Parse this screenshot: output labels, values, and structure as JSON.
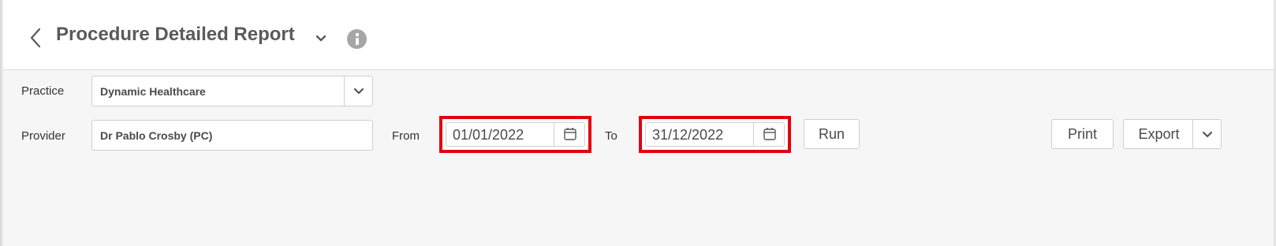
{
  "header": {
    "title": "Procedure Detailed Report"
  },
  "filters": {
    "practice_label": "Practice",
    "practice_value": "Dynamic Healthcare",
    "provider_label": "Provider",
    "provider_value": "Dr Pablo Crosby (PC)",
    "from_label": "From",
    "from_value": "01/01/2022",
    "to_label": "To",
    "to_value": "31/12/2022"
  },
  "actions": {
    "run_label": "Run",
    "print_label": "Print",
    "export_label": "Export"
  },
  "colors": {
    "highlight": "#e3000f",
    "info_icon": "#a6a6a6",
    "background": "#f6f6f6"
  },
  "icons": [
    "back-chevron-icon",
    "chevron-down-icon",
    "info-icon",
    "calendar-icon"
  ]
}
